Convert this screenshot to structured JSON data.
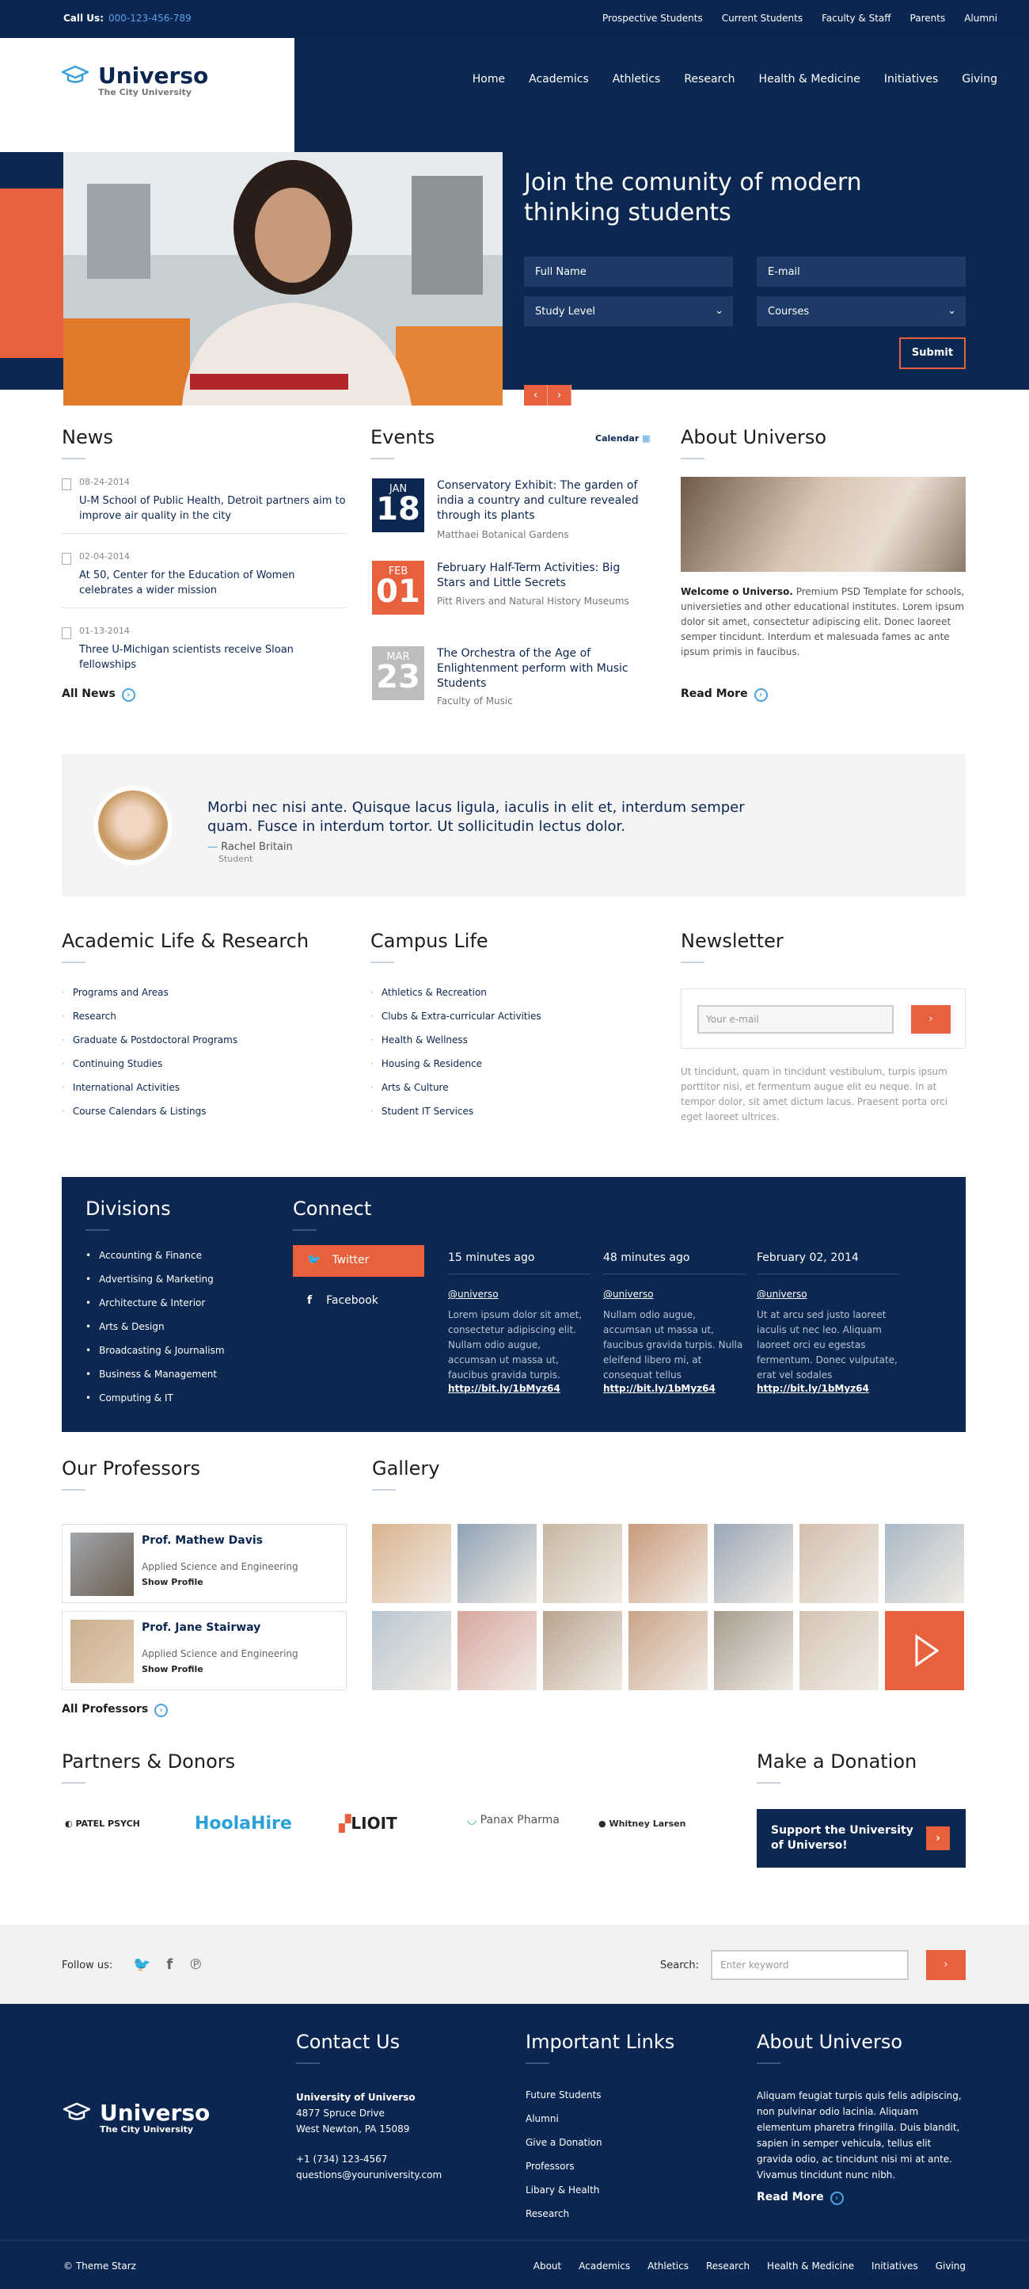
{
  "topbar": {
    "call_label": "Call Us:",
    "phone": "000-123-456-789",
    "links": [
      "Prospective Students",
      "Current Students",
      "Faculty & Staff",
      "Parents",
      "Alumni"
    ]
  },
  "brand": {
    "name": "Universo",
    "tagline": "The City University"
  },
  "nav": [
    "Home",
    "Academics",
    "Athletics",
    "Research",
    "Health & Medicine",
    "Initiatives",
    "Giving"
  ],
  "hero": {
    "title": "Join the comunity of modern thinking students",
    "full_name": "Full Name",
    "email": "E-mail",
    "study_level": "Study Level",
    "courses": "Courses",
    "submit": "Submit"
  },
  "news": {
    "title": "News",
    "items": [
      {
        "date": "08-24-2014",
        "text": "U-M School of Public Health, Detroit partners aim to improve air quality in the city"
      },
      {
        "date": "02-04-2014",
        "text": "At 50, Center for the Education of Women celebrates a wider mission"
      },
      {
        "date": "01-13-2014",
        "text": "Three U-Michigan scientists receive Sloan fellowships"
      }
    ],
    "more": "All News"
  },
  "events": {
    "title": "Events",
    "calendar": "Calendar",
    "items": [
      {
        "month": "JAN",
        "day": "18",
        "title": "Conservatory Exhibit: The garden of india a country and culture revealed through its plants",
        "place": "Matthaei Botanical Gardens",
        "color": "#0c2750"
      },
      {
        "month": "FEB",
        "day": "01",
        "title": "February Half-Term Activities: Big Stars and Little Secrets",
        "place": "Pitt Rivers and Natural History Museums",
        "color": "#e8603c"
      },
      {
        "month": "MAR",
        "day": "23",
        "title": "The Orchestra of the Age of Enlightenment perform with Music Students",
        "place": "Faculty of Music",
        "color": "#bdbdbd"
      }
    ]
  },
  "about": {
    "title": "About Universo",
    "lead": "Welcome o Universo.",
    "text": " Premium PSD Template for schools, universieties and other educational institutes. Lorem ipsum dolor sit amet, consectetur adipiscing elit. Donec laoreet semper tincidunt. Interdum et malesuada fames ac ante ipsum primis in faucibus.",
    "more": "Read More"
  },
  "testimonial": {
    "quote": "Morbi nec nisi ante. Quisque lacus ligula, iaculis in elit et, interdum semper quam. Fusce in interdum tortor. Ut sollicitudin lectus dolor.",
    "name": "Rachel Britain",
    "role": "Student"
  },
  "academic": {
    "title": "Academic Life & Research",
    "items": [
      "Programs and Areas",
      "Research",
      "Graduate & Postdoctoral Programs",
      "Continuing Studies",
      "International Activities",
      "Course Calendars & Listings"
    ]
  },
  "campus": {
    "title": "Campus Life",
    "items": [
      "Athletics & Recreation",
      "Clubs & Extra-curricular Activities",
      "Health & Wellness",
      "Housing & Residence",
      "Arts & Culture",
      "Student IT Services"
    ]
  },
  "newsletter": {
    "title": "Newsletter",
    "placeholder": "Your e-mail",
    "text": "Ut tincidunt, quam in tincidunt vestibulum, turpis ipsum porttitor nisi, et fermentum augue elit eu neque. In at tempor dolor, sit amet dictum lacus. Praesent porta orci eget laoreet ultrices."
  },
  "divisions": {
    "title": "Divisions",
    "items": [
      "Accounting & Finance",
      "Advertising & Marketing",
      "Architecture & Interior",
      "Arts & Design",
      "Broadcasting & Journalism",
      "Business & Management",
      "Computing & IT"
    ]
  },
  "connect": {
    "title": "Connect",
    "twitter": "Twitter",
    "facebook": "Facebook",
    "posts": [
      {
        "time": "15 minutes ago",
        "user": "@universo",
        "text": "Lorem ipsum dolor sit amet, consectetur adipiscing elit. Nullam odio augue, accumsan ut massa ut, faucibus gravida turpis.",
        "link": "http://bit.ly/1bMyz64"
      },
      {
        "time": "48 minutes ago",
        "user": "@universo",
        "text": "Nullam odio augue, accumsan ut massa ut, faucibus gravida turpis. Nulla eleifend libero mi, at consequat tellus",
        "link": "http://bit.ly/1bMyz64"
      },
      {
        "time": "February 02, 2014",
        "user": "@universo",
        "text": "Ut at arcu sed justo laoreet iaculis ut nec leo. Aliquam laoreet orci eu egestas fermentum. Donec vulputate, erat vel sodales",
        "link": "http://bit.ly/1bMyz64"
      }
    ]
  },
  "professors": {
    "title": "Our Professors",
    "items": [
      {
        "name": "Prof. Mathew Davis",
        "dept": "Applied Science and Engineering",
        "link": "Show Profile"
      },
      {
        "name": "Prof. Jane Stairway",
        "dept": "Applied Science and Engineering",
        "link": "Show Profile"
      }
    ],
    "more": "All Professors"
  },
  "gallery": {
    "title": "Gallery"
  },
  "partners": {
    "title": "Partners & Donors",
    "logos": [
      "PATEL PSYCH",
      "HoolaHire",
      "LIOIT",
      "Panax Pharma",
      "Whitney Larsen"
    ]
  },
  "donation": {
    "title": "Make a Donation",
    "text": "Support the University of Universo!"
  },
  "follow": {
    "label": "Follow us:",
    "search_label": "Search:",
    "search_placeholder": "Enter keyword"
  },
  "footer": {
    "contact_title": "Contact Us",
    "org": "University of Universo",
    "addr1": "4877 Spruce Drive",
    "addr2": "West Newton, PA 15089",
    "phone": "+1 (734) 123-4567",
    "email": "questions@youruniversity.com",
    "links_title": "Important Links",
    "links": [
      "Future Students",
      "Alumni",
      "Give a Donation",
      "Professors",
      "Libary & Health",
      "Research"
    ],
    "about_title": "About Universo",
    "about_text": "Aliquam feugiat turpis quis felis adipiscing, non pulvinar odio lacinia. Aliquam elementum pharetra fringilla. Duis blandit, sapien in semper vehicula, tellus elit gravida odio, ac tincidunt nisi mi at ante. Vivamus tincidunt nunc nibh.",
    "about_more": "Read More",
    "copyright": "© Theme Starz",
    "bottom_nav": [
      "About",
      "Academics",
      "Athletics",
      "Research",
      "Health & Medicine",
      "Initiatives",
      "Giving"
    ]
  }
}
